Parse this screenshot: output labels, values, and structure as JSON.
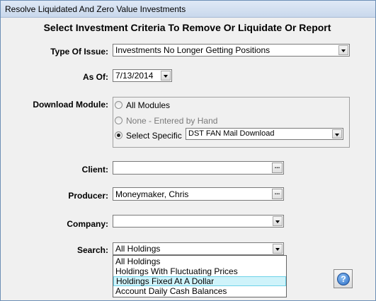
{
  "window": {
    "title": "Resolve Liquidated And Zero Value Investments"
  },
  "header": {
    "title": "Select Investment Criteria To Remove Or Liquidate Or Report"
  },
  "type_of_issue": {
    "label": "Type Of Issue:",
    "value": "Investments No Longer Getting  Positions"
  },
  "as_of": {
    "label": "As Of:",
    "value": "7/13/2014"
  },
  "download_module": {
    "label": "Download Module:",
    "options": [
      {
        "label": "All Modules",
        "selected": false,
        "enabled": true
      },
      {
        "label": "None - Entered by Hand",
        "selected": false,
        "enabled": false
      },
      {
        "label": "Select Specific",
        "selected": true,
        "enabled": true
      }
    ],
    "specific_value": "DST FAN Mail Download"
  },
  "client": {
    "label": "Client:",
    "value": "",
    "button": "..."
  },
  "producer": {
    "label": "Producer:",
    "value": "Moneymaker, Chris",
    "button": "..."
  },
  "company": {
    "label": "Company:",
    "value": ""
  },
  "search": {
    "label": "Search:",
    "value": "All Holdings",
    "options": [
      "All Holdings",
      "Holdings With Fluctuating Prices",
      "Holdings Fixed At A Dollar",
      "Account Daily Cash Balances"
    ],
    "highlighted_index": 2
  },
  "help": {
    "label": "?"
  }
}
